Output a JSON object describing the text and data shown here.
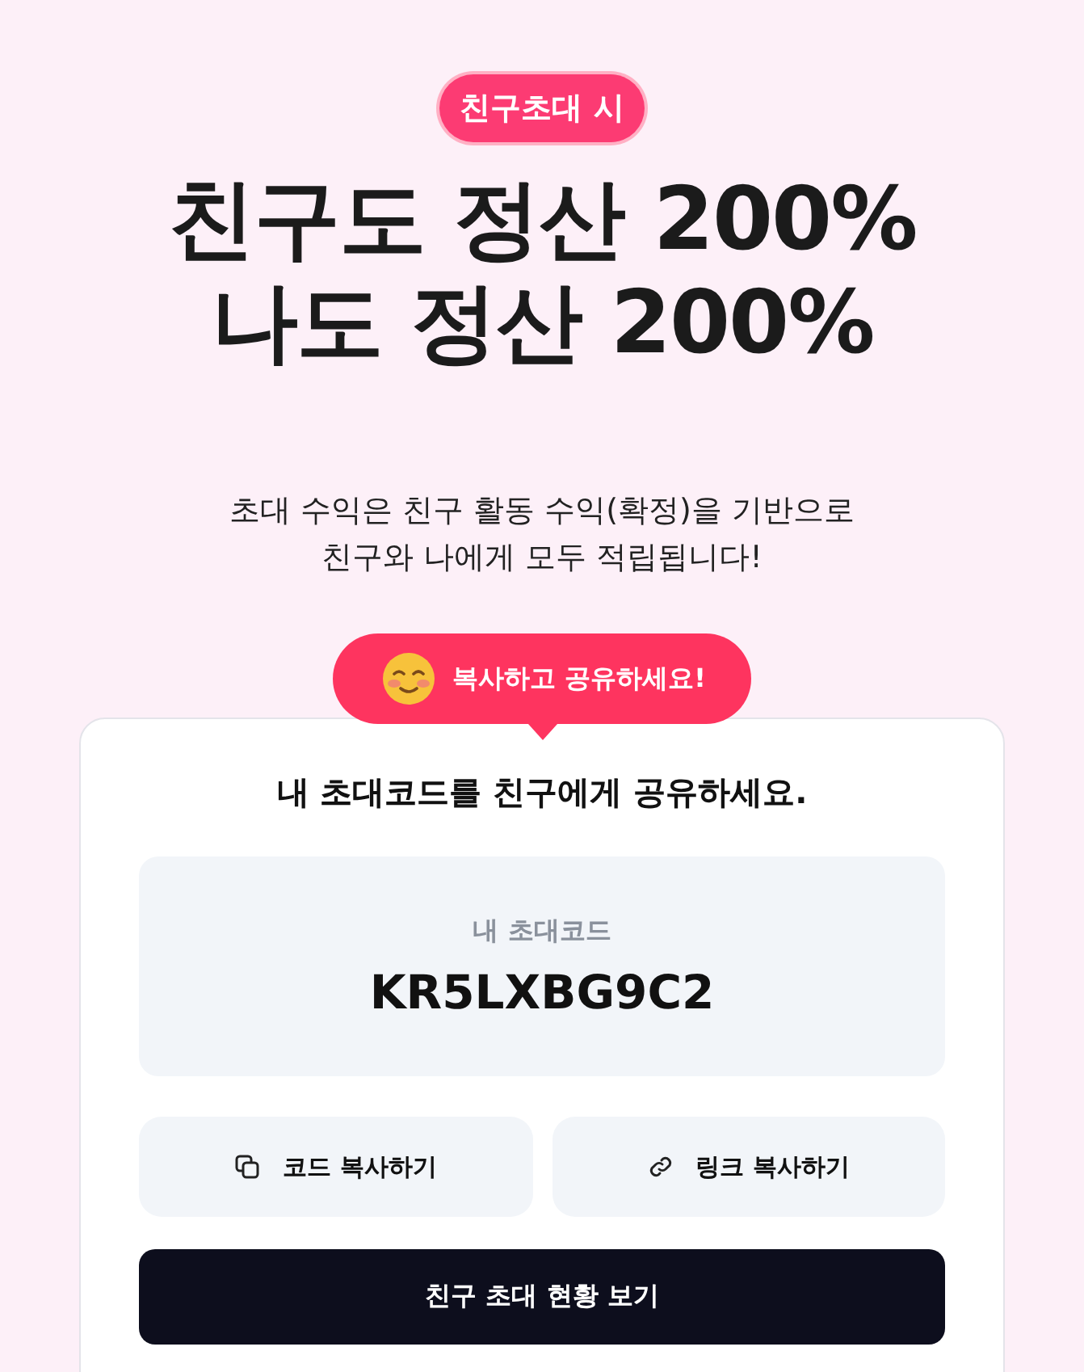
{
  "badge": "친구초대 시",
  "headline": [
    "친구도 정산 200%",
    "나도 정산 200%"
  ],
  "description": [
    "초대 수익은 친구 활동 수익(확정)을 기반으로",
    "친구와 나에게 모두 적립됩니다!"
  ],
  "tooltip": "복사하고 공유하세요!",
  "card": {
    "title": "내 초대코드를 친구에게 공유하세요.",
    "code_label": "내 초대코드",
    "code": "KR5LXBG9C2",
    "actions": [
      {
        "kind": "copy",
        "label": "코드 복사하기"
      },
      {
        "kind": "link",
        "label": "링크 복사하기"
      }
    ],
    "primary_button": "친구 초대 현황 보기"
  }
}
